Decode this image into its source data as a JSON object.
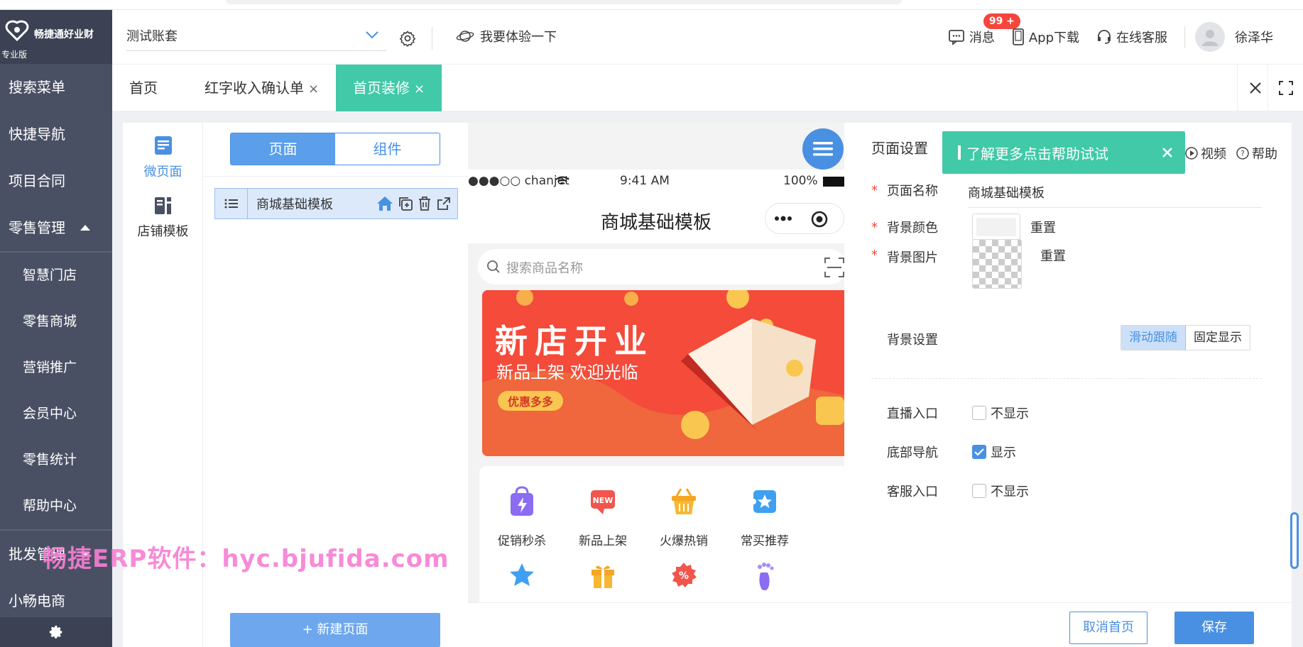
{
  "brand": {
    "name": "畅捷通好业财",
    "edition": "专业版"
  },
  "sidebar": {
    "items": [
      {
        "label": "搜索菜单"
      },
      {
        "label": "快捷导航"
      },
      {
        "label": "项目合同"
      },
      {
        "label": "零售管理"
      },
      {
        "label": "智慧门店"
      },
      {
        "label": "零售商城"
      },
      {
        "label": "营销推广"
      },
      {
        "label": "会员中心"
      },
      {
        "label": "零售统计"
      },
      {
        "label": "帮助中心"
      },
      {
        "label": "批发管理"
      },
      {
        "label": "小畅电商"
      }
    ]
  },
  "header": {
    "account": "测试账套",
    "experience": "我要体验一下",
    "messages": "消息",
    "message_badge": "99 +",
    "app_download": "App下载",
    "online_service": "在线客服",
    "user": "徐泽华"
  },
  "tabs": [
    {
      "label": "首页"
    },
    {
      "label": "红字收入确认单",
      "close": "×"
    },
    {
      "label": "首页装修",
      "close": "×"
    }
  ],
  "type_panel": {
    "micro_page": "微页面",
    "shop_template": "店铺模板"
  },
  "page_panel": {
    "seg_page": "页面",
    "seg_component": "组件",
    "row_name": "商城基础模板",
    "new_page": "+ 新建页面"
  },
  "preview": {
    "carrier": "●●●○○ chanjet",
    "time": "9:41 AM",
    "battery": "100%",
    "title": "商城基础模板",
    "search_placeholder": "搜索商品名称",
    "banner_title": "新店开业",
    "banner_sub": "新品上架 欢迎光临",
    "banner_tag": "优惠多多",
    "icons": [
      {
        "label": "促销秒杀"
      },
      {
        "label": "新品上架"
      },
      {
        "label": "火爆热销"
      },
      {
        "label": "常买推荐"
      }
    ]
  },
  "settings": {
    "title": "页面设置",
    "toast": "了解更多点击帮助试试",
    "video": "视频",
    "help": "帮助",
    "page_name_label": "页面名称",
    "page_name_value": "商城基础模板",
    "bg_color_label": "背景颜色",
    "bg_image_label": "背景图片",
    "reset": "重置",
    "bg_setting_label": "背景设置",
    "bg_follow": "滑动跟随",
    "bg_fixed": "固定显示",
    "live_label": "直播入口",
    "live_value": "不显示",
    "bottom_nav_label": "底部导航",
    "bottom_nav_value": "显示",
    "service_label": "客服入口",
    "service_value": "不显示",
    "required_mark": "*"
  },
  "actions": {
    "cancel_home": "取消首页",
    "save": "保存"
  },
  "watermark": "畅捷ERP软件：hyc.bjufida.com",
  "colors": {
    "sidebar": "#4a5064",
    "accent_green": "#41c9a8",
    "primary_blue": "#4a90e2",
    "badge_red": "#f5453d"
  }
}
